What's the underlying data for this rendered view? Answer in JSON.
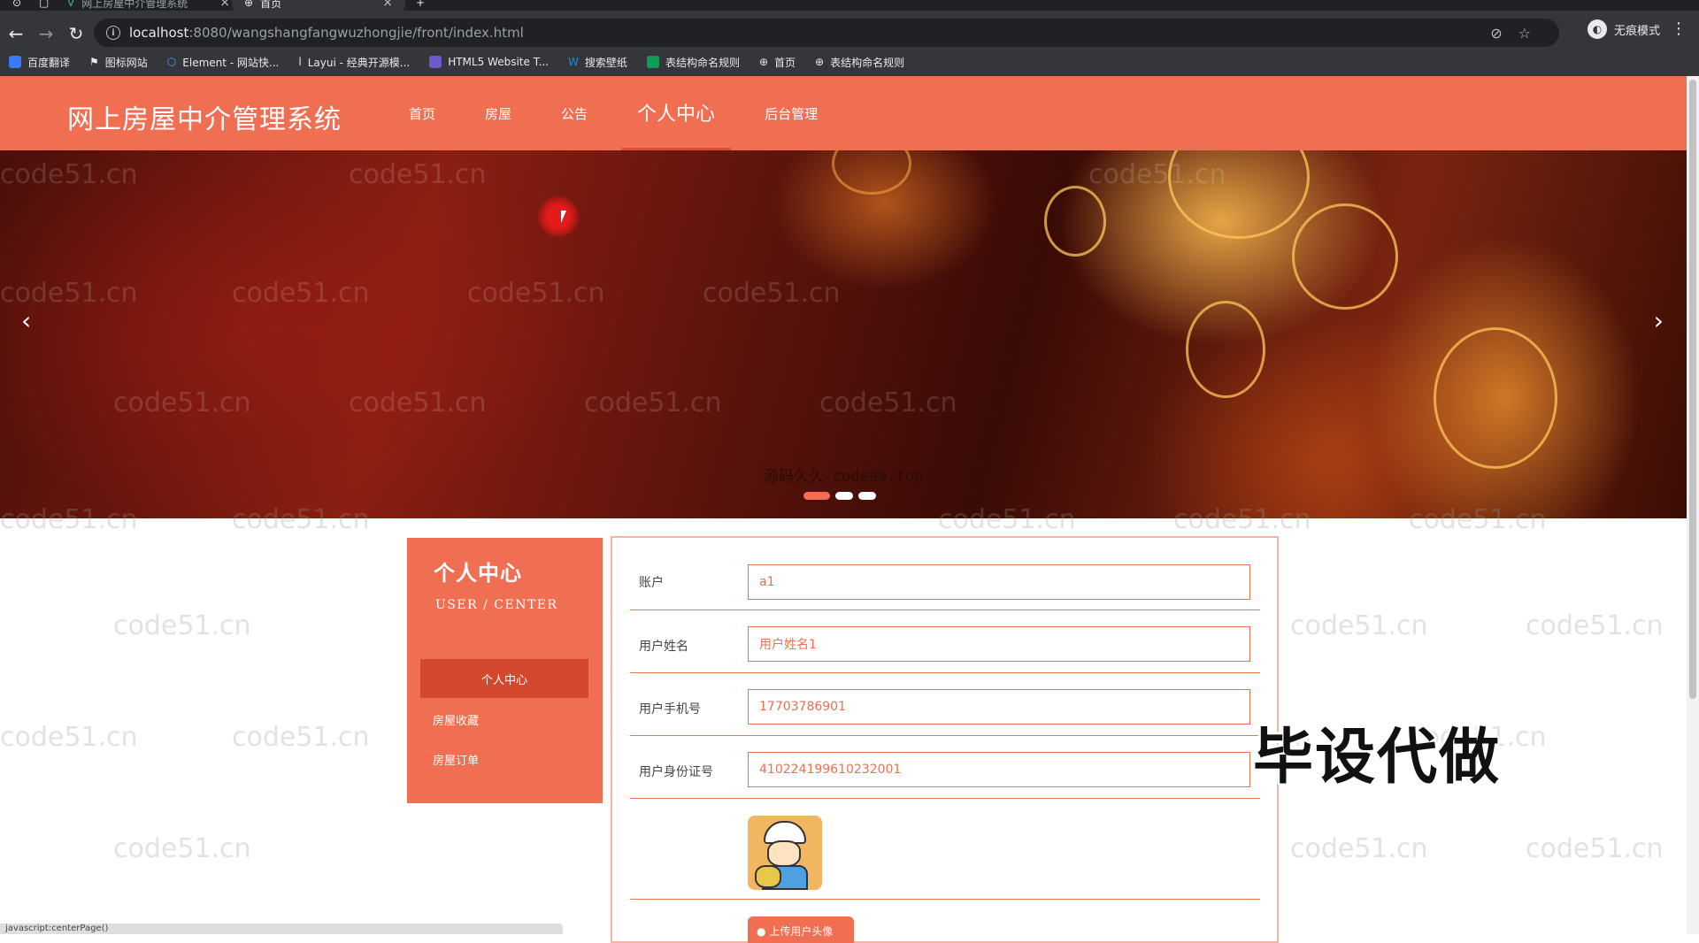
{
  "browser": {
    "tabs": [
      {
        "title": "网上房屋中介管理系统",
        "icon": "vue-icon"
      },
      {
        "title": "首页",
        "icon": "globe-icon"
      }
    ],
    "url_host": "localhost",
    "url_path": ":8080/wangshangfangwuzhongjie/front/index.html",
    "incognito_label": "无痕模式",
    "bookmarks": [
      {
        "label": "百度翻译",
        "color": "#3b7bf7"
      },
      {
        "label": "图标网站",
        "color": "#ffffff"
      },
      {
        "label": "Element - 网站快...",
        "color": "#409eff"
      },
      {
        "label": "Layui - 经典开源模...",
        "color": "#888888"
      },
      {
        "label": "HTML5 Website T...",
        "color": "#6a5acd"
      },
      {
        "label": "搜索壁纸",
        "color": "#1e88e5"
      },
      {
        "label": "表结构命名规则",
        "color": "#0f9d58"
      },
      {
        "label": "首页",
        "color": "#9aa0a6"
      },
      {
        "label": "表结构命名规则",
        "color": "#9aa0a6"
      }
    ],
    "status_url": "javascript:centerPage()"
  },
  "site": {
    "title": "网上房屋中介管理系统",
    "nav": [
      "首页",
      "房屋",
      "公告",
      "个人中心",
      "后台管理"
    ],
    "active_nav": "个人中心",
    "accent_color": "#f06e52"
  },
  "banner": {
    "caption": "源码久久-code99.top",
    "slide_count": 3,
    "active_slide": 0
  },
  "watermark": "code51.cn",
  "sidebar": {
    "title": "个人中心",
    "subtitle": "USER / CENTER",
    "items": [
      "个人中心",
      "房屋收藏",
      "房屋订单"
    ]
  },
  "form": {
    "fields": [
      {
        "label": "账户",
        "value": "a1"
      },
      {
        "label": "用户姓名",
        "value": "用户姓名1"
      },
      {
        "label": "用户手机号",
        "value": "17703786901"
      },
      {
        "label": "用户身份证号",
        "value": "410224199610232001"
      }
    ],
    "upload_label": "上传用户头像"
  },
  "overlay_text": "毕设代做"
}
